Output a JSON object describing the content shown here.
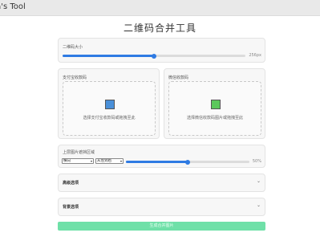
{
  "window": {
    "title": "ra's Tool"
  },
  "page": {
    "title": "二维码合并工具"
  },
  "qr_size": {
    "label": "二维码大小",
    "value": 256,
    "min": 0,
    "max": 512,
    "value_text": "256px"
  },
  "alipay": {
    "title": "支付宝收款码",
    "hint": "选择支付宝收款码或拖拽至此",
    "color": "#4a90d9"
  },
  "wechat": {
    "title": "微信收款码",
    "hint": "选择微信收款码图片或拖拽至此",
    "color": "#5cc85c"
  },
  "layout": {
    "label": "上层图片遮挡区域",
    "direction": "横向",
    "order": "从左到右",
    "value": 50,
    "value_text": "50%"
  },
  "advanced": {
    "title": "高级选项"
  },
  "background": {
    "title": "背景选项"
  },
  "generate": {
    "label": "生成合并图片"
  },
  "colors": {
    "accent": "#2f7be3",
    "button": "#6fe0a8"
  }
}
